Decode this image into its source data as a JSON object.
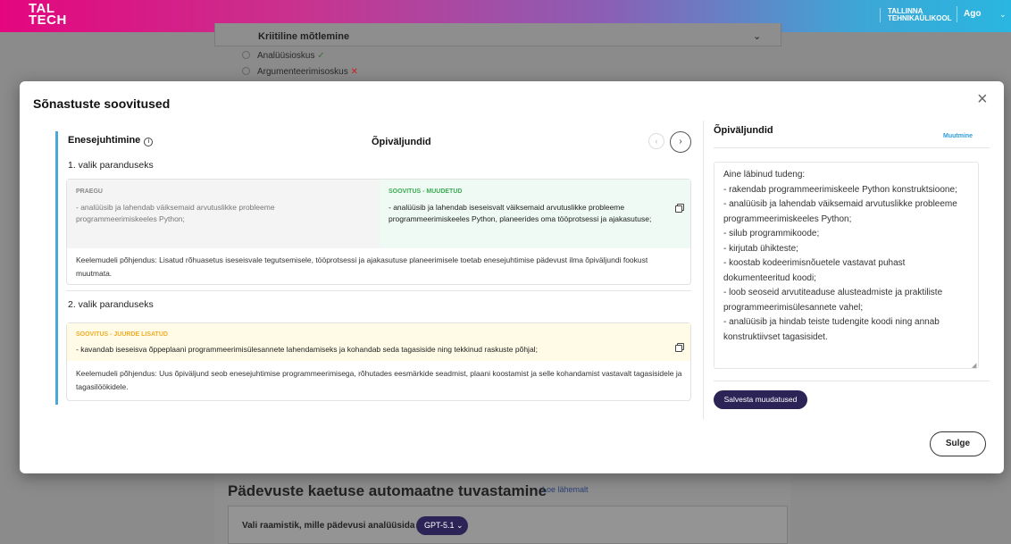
{
  "topbar": {
    "logo_line1": "TAL",
    "logo_line2": "TECH",
    "university_line1": "TALLINNA",
    "university_line2": "TEHNIKAÜLIKOOL",
    "user_label": "Ago",
    "accent_colors": [
      "#e4067e",
      "#29b6e0"
    ]
  },
  "background": {
    "card_title": "Kriitiline mõtlemine",
    "checks": [
      {
        "label": "Analüüsioskus",
        "mark": "✓",
        "status": "ok"
      },
      {
        "label": "Argumenteerimisoskus",
        "mark": "✕",
        "status": "bad"
      }
    ],
    "section_title": "Pädevuste kaetuse automaatne tuvastamine",
    "section_link": "Loe lähemalt",
    "select_label": "Vali raamistik, mille pädevusi analüüsida",
    "select_value": "GPT-5.1"
  },
  "modal": {
    "title": "Sõnastuste soovitused",
    "competence": "Enesejuhtimine",
    "column_heading": "Õpiväljundid",
    "option1": {
      "label": "1. valik paranduseks",
      "current_label": "PRAEGU",
      "current_text": "- analüüsib ja lahendab väiksemaid arvutuslikke probleeme programmeerimiskeeles Python;",
      "suggest_label": "SOOVITUS - MUUDETUD",
      "suggest_text": "- analüüsib ja lahendab iseseisvalt väiksemaid arvutuslikke probleeme programmeerimiskeeles Python, planeerides oma tööprotsessi ja ajakasutuse;",
      "reason": "Keelemudeli põhjendus: Lisatud rõhuasetus iseseisvale tegutsemisele, tööprotsessi ja ajakasutuse planeerimisele toetab enesejuhtimise pädevust ilma õpiväljundi fookust muutmata."
    },
    "option2": {
      "label": "2. valik paranduseks",
      "suggest_label": "SOOVITUS - JUURDE LISATUD",
      "suggest_text": "- kavandab iseseisva õppeplaani programmeerimisülesannete lahendamiseks ja kohandab seda tagasiside ning tekkinud raskuste põhjal;",
      "reason": "Keelemudeli põhjendus: Uus õpiväljund seob enesejuhtimise programmeerimisega, rõhutades eesmärkide seadmist, plaani koostamist ja selle kohandamist vastavalt tagasisidele ja tagasilöökidele."
    },
    "right_panel": {
      "title": "Õpiväljundid",
      "link": "Muutmine",
      "text": "Aine läbinud tudeng:\n- rakendab programmeerimiskeele Python konstruktsioone;\n- analüüsib ja lahendab väiksemaid arvutuslikke probleeme programmeerimiskeeles Python;\n- silub programmikoode;\n- kirjutab ühikteste;\n- koostab kodeerimisnõuetele vastavat puhast dokumenteeritud koodi;\n- loob seoseid arvutiteaduse alusteadmiste ja praktiliste programmeerimisülesannete vahel;\n- analüüsib ja hindab teiste tudengite koodi ning annab konstruktiivset tagasisidet.",
      "save_label": "Salvesta muudatused"
    },
    "close_label": "Sulge",
    "colors": {
      "rail": "#49a8da",
      "modified": "#3cab53",
      "added": "#f0ae28",
      "primary": "#2c2456"
    }
  }
}
